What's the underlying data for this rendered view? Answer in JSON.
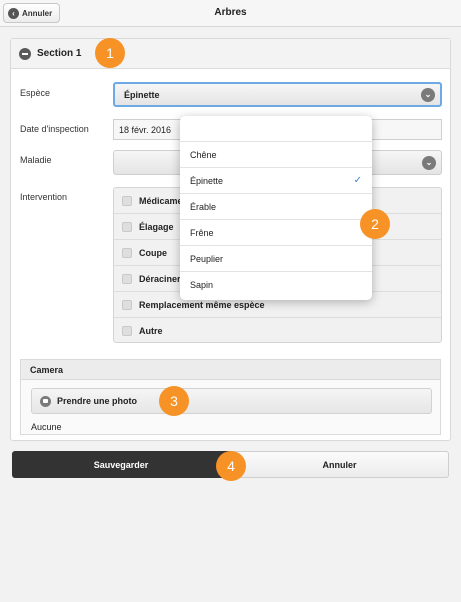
{
  "topbar": {
    "back_label": "Annuler",
    "title": "Arbres"
  },
  "section": {
    "title": "Section 1"
  },
  "fields": {
    "espece": {
      "label": "Espèce",
      "value": "Épinette"
    },
    "date": {
      "label": "Date d'inspection",
      "value": "18 févr. 2016"
    },
    "maladie": {
      "label": "Maladie",
      "value": ""
    },
    "intervention": {
      "label": "Intervention",
      "items": [
        {
          "label": "Médicame"
        },
        {
          "label": "Élagage"
        },
        {
          "label": "Coupe"
        },
        {
          "label": "Déraciner"
        },
        {
          "label": "Remplacement même espèce"
        },
        {
          "label": "Autre"
        }
      ]
    }
  },
  "camera": {
    "header": "Camera",
    "button_label": "Prendre une photo",
    "status": "Aucune"
  },
  "actions": {
    "save_label": "Sauvegarder",
    "cancel_label": "Annuler"
  },
  "dropdown": {
    "options": [
      {
        "label": "Chêne",
        "selected": false
      },
      {
        "label": "Épinette",
        "selected": true
      },
      {
        "label": "Érable",
        "selected": false
      },
      {
        "label": "Frêne",
        "selected": false
      },
      {
        "label": "Peuplier",
        "selected": false
      },
      {
        "label": "Sapin",
        "selected": false
      }
    ],
    "check_glyph": "✓"
  },
  "badges": [
    "1",
    "2",
    "3",
    "4"
  ],
  "colors": {
    "badge": "#f79226",
    "save_button": "#333333",
    "focus_border": "#6da9e4",
    "check": "#3b82d6"
  }
}
